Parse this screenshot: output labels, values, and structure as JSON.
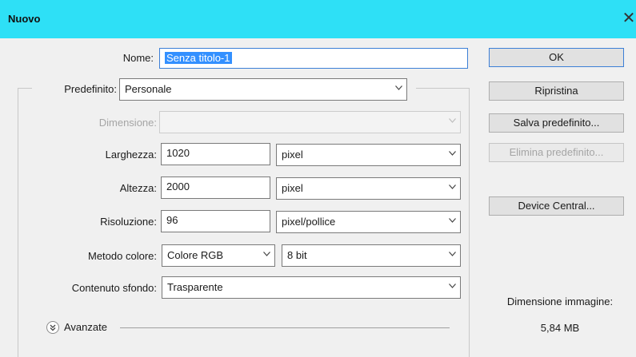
{
  "window": {
    "title": "Nuovo"
  },
  "form": {
    "name_label": "Nome:",
    "name_value": "Senza titolo-1",
    "preset_label": "Predefinito:",
    "preset_value": "Personale",
    "size_label": "Dimensione:",
    "size_value": "",
    "width_label": "Larghezza:",
    "width_value": "1020",
    "width_unit": "pixel",
    "height_label": "Altezza:",
    "height_value": "2000",
    "height_unit": "pixel",
    "resolution_label": "Risoluzione:",
    "resolution_value": "96",
    "resolution_unit": "pixel/pollice",
    "color_mode_label": "Metodo colore:",
    "color_mode_value": "Colore RGB",
    "bit_depth_value": "8 bit",
    "background_label": "Contenuto sfondo:",
    "background_value": "Trasparente",
    "advanced_label": "Avanzate"
  },
  "buttons": {
    "ok": "OK",
    "reset": "Ripristina",
    "save_preset": "Salva predefinito...",
    "delete_preset": "Elimina predefinito...",
    "device_central": "Device Central..."
  },
  "image_size": {
    "label": "Dimensione immagine:",
    "value": "5,84 MB"
  },
  "colors": {
    "titlebar": "#2ee0f6",
    "focus_border": "#3c7fd6",
    "selection": "#3390ff"
  }
}
